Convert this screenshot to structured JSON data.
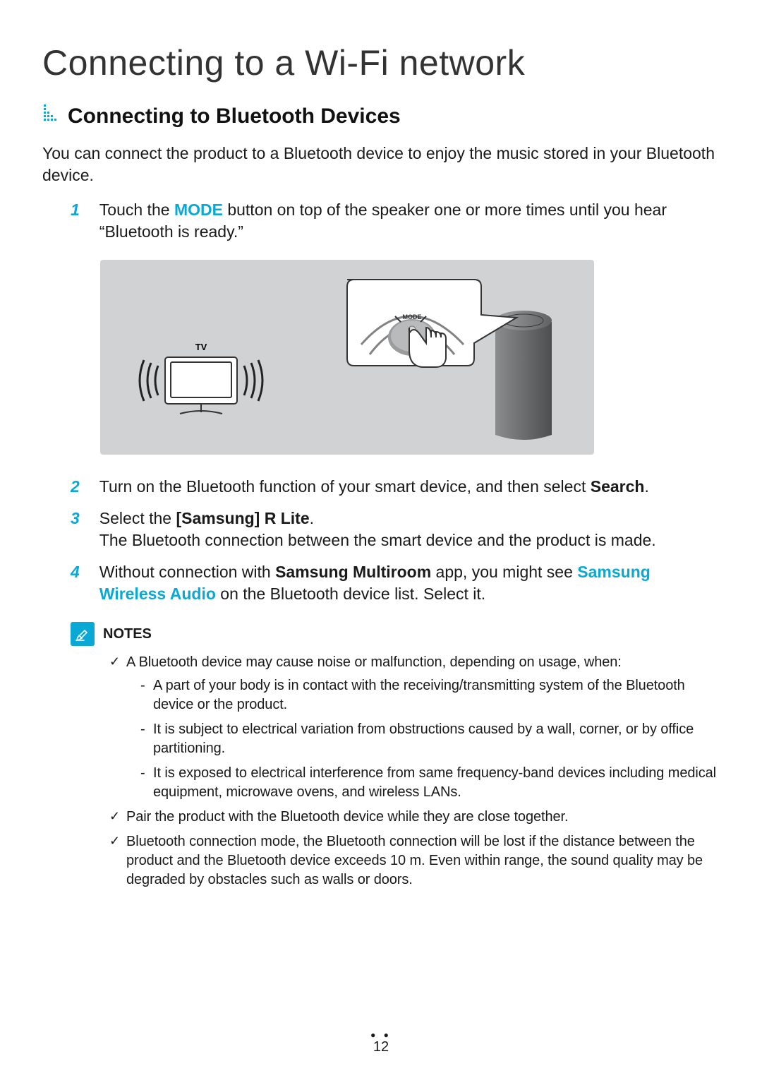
{
  "page_title": "Connecting to a Wi-Fi network",
  "section_heading": "Connecting to Bluetooth Devices",
  "intro": "You can connect the product to a Bluetooth device to enjoy the music stored in your Bluetooth device.",
  "steps": [
    {
      "num": "1",
      "pre": "Touch the ",
      "hl": "MODE",
      "post": " button on top of the speaker one or more times until you hear “Bluetooth is ready.”"
    },
    {
      "num": "2",
      "pre": "Turn on the Bluetooth function of your smart device, and then select ",
      "bold": "Search",
      "post": "."
    },
    {
      "num": "3",
      "line1_pre": "Select the ",
      "line1_bold": "[Samsung] R Lite",
      "line1_post": ".",
      "line2": "The Bluetooth connection between the smart device and the product is made."
    },
    {
      "num": "4",
      "pre": "Without connection with ",
      "bold1": "Samsung Multiroom",
      "mid": " app, you might see ",
      "hl": "Samsung Wireless Audio",
      "post": " on the Bluetooth device list. Select it."
    }
  ],
  "diagram": {
    "tv_label": "TV",
    "mode_label": "MODE"
  },
  "notes_label": "NOTES",
  "notes": [
    {
      "text": "A Bluetooth device may cause noise or malfunction, depending on usage, when:",
      "sub": [
        "A part of your body is in contact with the receiving/transmitting system of the Bluetooth device or the product.",
        "It is subject to electrical variation from obstructions caused by a wall, corner, or by office partitioning.",
        "It is exposed to electrical interference from same frequency-band devices including medical equipment, microwave ovens, and wireless LANs."
      ]
    },
    {
      "text": "Pair the product with the Bluetooth device while they are close together."
    },
    {
      "text": "Bluetooth connection mode, the Bluetooth connection will be lost if the distance between the product and the Bluetooth device exceeds 10 m. Even within range, the sound quality may be degraded by obstacles such as walls or doors."
    }
  ],
  "page_number": "12"
}
